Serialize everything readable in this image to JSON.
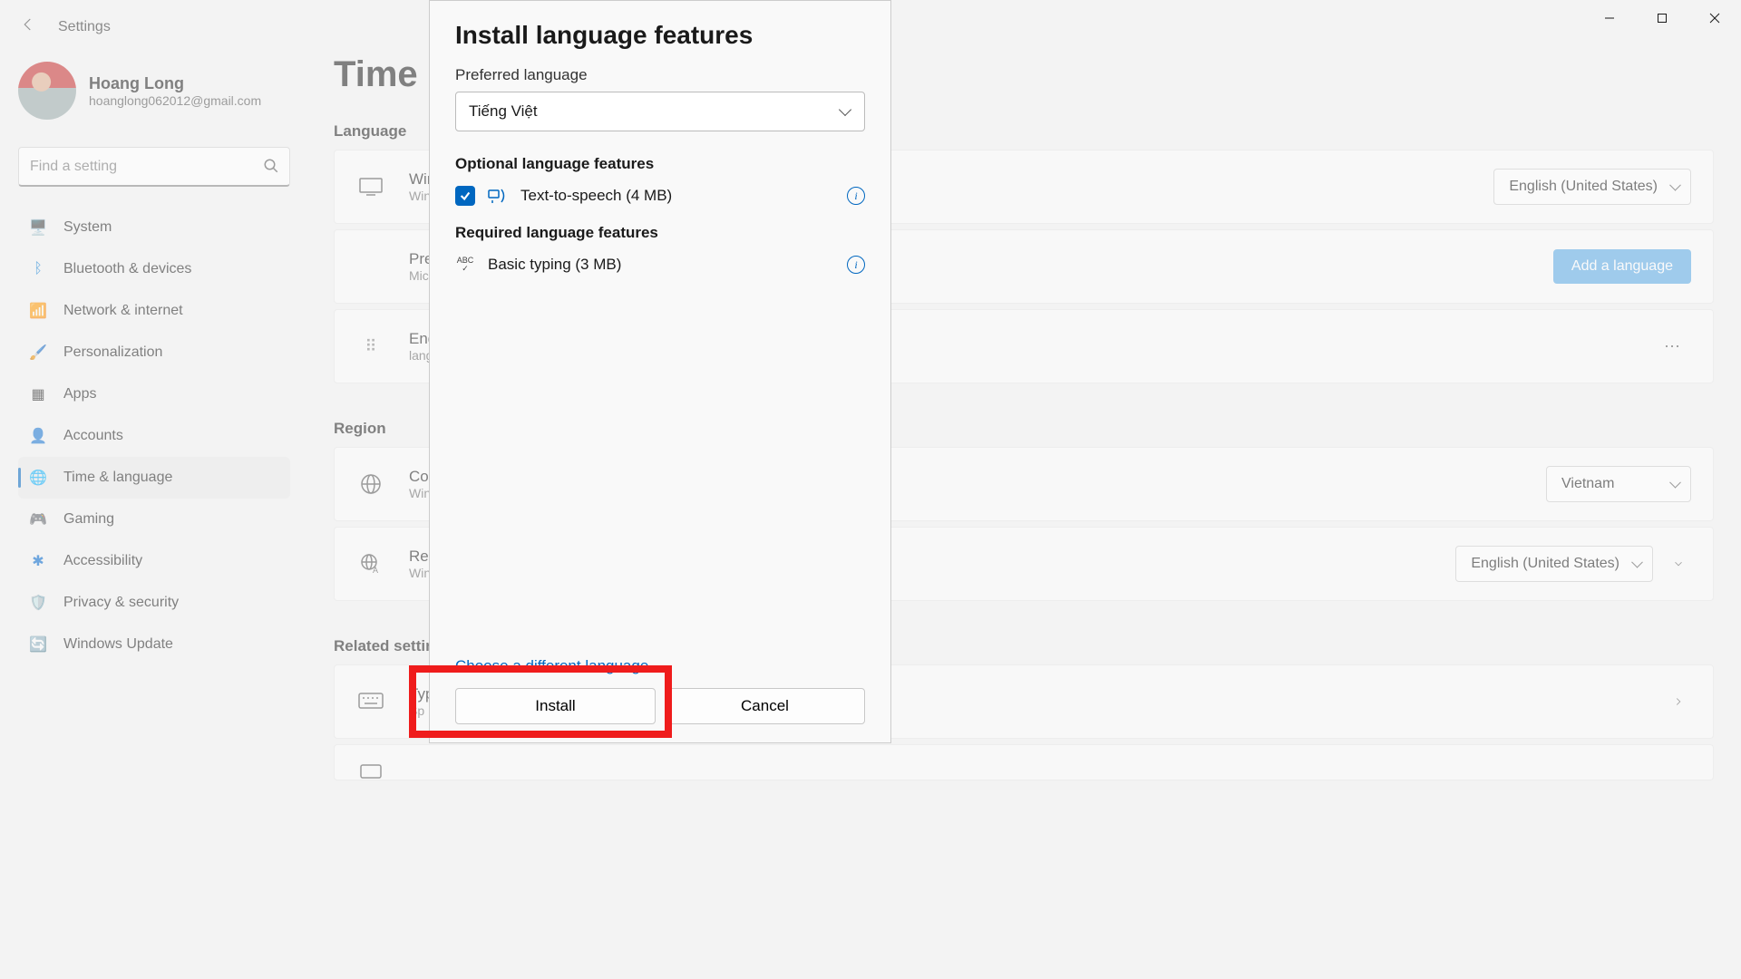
{
  "header": {
    "title": "Settings"
  },
  "profile": {
    "name": "Hoang Long",
    "email": "hoanglong062012@gmail.com"
  },
  "search": {
    "placeholder": "Find a setting"
  },
  "nav": {
    "items": [
      {
        "label": "System"
      },
      {
        "label": "Bluetooth & devices"
      },
      {
        "label": "Network & internet"
      },
      {
        "label": "Personalization"
      },
      {
        "label": "Apps"
      },
      {
        "label": "Accounts"
      },
      {
        "label": "Time & language"
      },
      {
        "label": "Gaming"
      },
      {
        "label": "Accessibility"
      },
      {
        "label": "Privacy & security"
      },
      {
        "label": "Windows Update"
      }
    ]
  },
  "page": {
    "title": "Time &"
  },
  "sections": {
    "language": "Language",
    "region": "Region",
    "related": "Related setting"
  },
  "cards": {
    "windisp": {
      "title": "Wind",
      "sub": "Wind",
      "value": "English (United States)"
    },
    "preflang": {
      "title": "Preferred lan",
      "sub": "Microsoft Stor",
      "button": "Add a language"
    },
    "english": {
      "title": "Englis",
      "sub": "languag"
    },
    "country": {
      "title": "Coun",
      "sub": "Wind",
      "value": "Vietnam"
    },
    "regfmt": {
      "title": "Regio",
      "sub": "Wind",
      "value": "English (United States)"
    },
    "typing": {
      "title": "Typin",
      "sub": "Sp"
    }
  },
  "dialog": {
    "title": "Install language features",
    "pref_label": "Preferred language",
    "pref_value": "Tiếng Việt",
    "optional_section": "Optional language features",
    "tts": "Text-to-speech (4 MB)",
    "required_section": "Required language features",
    "basic": "Basic typing (3 MB)",
    "choose_link": "Choose a different language",
    "install": "Install",
    "cancel": "Cancel"
  }
}
